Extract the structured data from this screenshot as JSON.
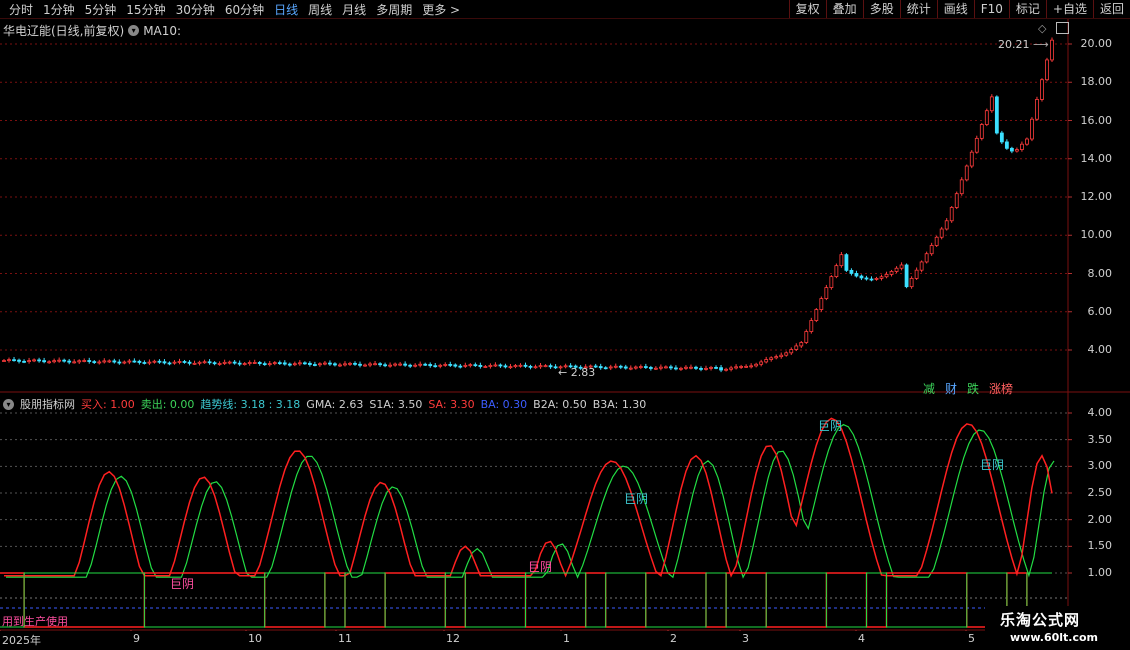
{
  "toolbar": {
    "periods": [
      "分时",
      "1分钟",
      "5分钟",
      "15分钟",
      "30分钟",
      "60分钟",
      "日线",
      "周线",
      "月线",
      "多周期",
      "更多"
    ],
    "active_period": "日线",
    "more_arrow": ">",
    "right_buttons": [
      "复权",
      "叠加",
      "多股",
      "统计",
      "画线",
      "F10",
      "标记",
      "+自选",
      "返回"
    ]
  },
  "main_chart": {
    "title": "华电辽能(日线,前复权)",
    "ma_label": "MA10:",
    "high_marker": "20.21",
    "low_marker": "2.83",
    "y_ticks": [
      "20.00",
      "18.00",
      "16.00",
      "14.00",
      "12.00",
      "10.00",
      "8.00",
      "6.00",
      "4.00"
    ],
    "y_values": [
      20,
      18,
      16,
      14,
      12,
      10,
      8,
      6,
      4
    ],
    "tags": [
      {
        "text": "减",
        "color": "#3cd45a"
      },
      {
        "text": "财",
        "color": "#59a7ff"
      },
      {
        "text": "跌",
        "color": "#3cd45a"
      },
      {
        "text": "涨榜",
        "color": "#ff6060"
      }
    ]
  },
  "indicator": {
    "name": "股朋指标网",
    "fields": [
      {
        "text": "买入: 1.00",
        "color": "#ff3c3c"
      },
      {
        "text": "卖出: 0.00",
        "color": "#3cd45a"
      },
      {
        "text": "趋势线: 3.18 : 3.18",
        "color": "#3cc8d0"
      },
      {
        "text": "GMA: 2.63",
        "color": "#d0d0d0"
      },
      {
        "text": "S1A: 3.50",
        "color": "#d0d0d0"
      },
      {
        "text": "SA: 3.30",
        "color": "#ff3c3c"
      },
      {
        "text": "BA: 0.30",
        "color": "#3c5cff"
      },
      {
        "text": "B2A: 0.50",
        "color": "#d0d0d0"
      },
      {
        "text": "B3A: 1.30",
        "color": "#d0d0d0"
      }
    ],
    "y_ticks": [
      "4.00",
      "3.50",
      "3.00",
      "2.50",
      "2.00",
      "1.50",
      "1.00"
    ],
    "y_values": [
      4,
      3.5,
      3,
      2.5,
      2,
      1.5,
      1
    ],
    "annotations": [
      "巨阴",
      "巨阴",
      "巨阴",
      "巨阴",
      "巨阴"
    ],
    "bottom_note": "用到生产使用"
  },
  "x_axis": {
    "labels": [
      "2025年",
      "9",
      "10",
      "11",
      "12",
      "1",
      "2",
      "3",
      "4",
      "5"
    ]
  },
  "watermark": {
    "line1": "乐淘公式网",
    "line2": "www.60lt.com"
  },
  "colors": {
    "up": "#ff3c3c",
    "down": "#3ce0ff",
    "grid": "#7a1010",
    "bg": "#000000",
    "buy": "#ff2020",
    "sell": "#22dd44",
    "trend": "#3cc8d0"
  }
}
